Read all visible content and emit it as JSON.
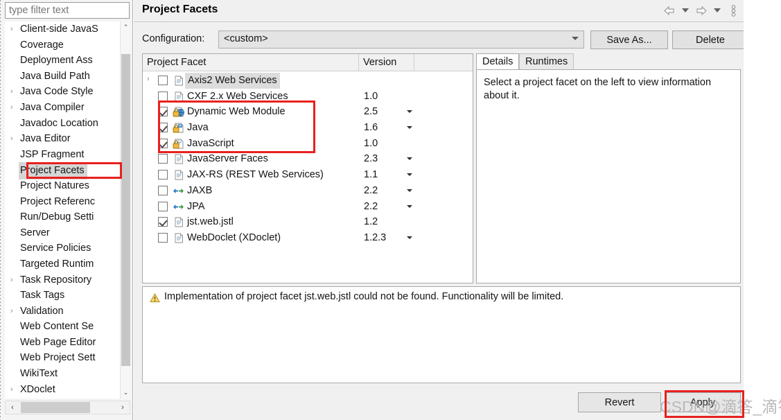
{
  "sidebar": {
    "filter": {
      "placeholder": "type filter text",
      "value": ""
    },
    "items": [
      {
        "label": "Client-side JavaS",
        "expandable": true,
        "selected": false
      },
      {
        "label": "Coverage",
        "expandable": false,
        "selected": false
      },
      {
        "label": "Deployment Ass",
        "expandable": false,
        "selected": false
      },
      {
        "label": "Java Build Path",
        "expandable": false,
        "selected": false
      },
      {
        "label": "Java Code Style",
        "expandable": true,
        "selected": false
      },
      {
        "label": "Java Compiler",
        "expandable": true,
        "selected": false
      },
      {
        "label": "Javadoc Location",
        "expandable": false,
        "selected": false
      },
      {
        "label": "Java Editor",
        "expandable": true,
        "selected": false
      },
      {
        "label": "JSP Fragment",
        "expandable": false,
        "selected": false
      },
      {
        "label": "Project Facets",
        "expandable": false,
        "selected": true
      },
      {
        "label": "Project Natures",
        "expandable": false,
        "selected": false
      },
      {
        "label": "Project Referenc",
        "expandable": false,
        "selected": false
      },
      {
        "label": "Run/Debug Setti",
        "expandable": false,
        "selected": false
      },
      {
        "label": "Server",
        "expandable": false,
        "selected": false
      },
      {
        "label": "Service Policies",
        "expandable": false,
        "selected": false
      },
      {
        "label": "Targeted Runtim",
        "expandable": false,
        "selected": false
      },
      {
        "label": "Task Repository",
        "expandable": true,
        "selected": false
      },
      {
        "label": "Task Tags",
        "expandable": false,
        "selected": false
      },
      {
        "label": "Validation",
        "expandable": true,
        "selected": false
      },
      {
        "label": "Web Content Se",
        "expandable": false,
        "selected": false
      },
      {
        "label": "Web Page Editor",
        "expandable": false,
        "selected": false
      },
      {
        "label": "Web Project Sett",
        "expandable": false,
        "selected": false
      },
      {
        "label": "WikiText",
        "expandable": false,
        "selected": false
      },
      {
        "label": "XDoclet",
        "expandable": true,
        "selected": false
      }
    ],
    "scroll_up_glyph": "⌃",
    "scroll_down_glyph": "⌄",
    "scroll_left_glyph": "‹",
    "scroll_right_glyph": "›"
  },
  "header": {
    "title": "Project Facets",
    "nav_icons": [
      "back-arrow-icon",
      "back-dropdown-icon",
      "forward-arrow-icon",
      "forward-dropdown-icon",
      "view-menu-icon"
    ]
  },
  "configuration": {
    "label": "Configuration:",
    "value": "<custom>",
    "save_as_label": "Save As...",
    "delete_label": "Delete"
  },
  "facets_table": {
    "columns": [
      "Project Facet",
      "Version",
      ""
    ],
    "rows": [
      {
        "name": "Axis2 Web Services",
        "version": "",
        "checked": false,
        "expandable": true,
        "locked": false,
        "icon": "doc-icon",
        "has_menu": false,
        "highlighted": true
      },
      {
        "name": "CXF 2.x Web Services",
        "version": "1.0",
        "checked": false,
        "expandable": false,
        "locked": false,
        "icon": "doc-icon",
        "has_menu": false,
        "highlighted": false
      },
      {
        "name": "Dynamic Web Module",
        "version": "2.5",
        "checked": true,
        "expandable": false,
        "locked": true,
        "icon": "web-icon",
        "has_menu": true,
        "highlighted": false
      },
      {
        "name": "Java",
        "version": "1.6",
        "checked": true,
        "expandable": false,
        "locked": true,
        "icon": "java-icon",
        "has_menu": true,
        "highlighted": false
      },
      {
        "name": "JavaScript",
        "version": "1.0",
        "checked": true,
        "expandable": false,
        "locked": true,
        "icon": "js-icon",
        "has_menu": false,
        "highlighted": false
      },
      {
        "name": "JavaServer Faces",
        "version": "2.3",
        "checked": false,
        "expandable": false,
        "locked": false,
        "icon": "doc-icon",
        "has_menu": true,
        "highlighted": false
      },
      {
        "name": "JAX-RS (REST Web Services)",
        "version": "1.1",
        "checked": false,
        "expandable": false,
        "locked": false,
        "icon": "doc-icon",
        "has_menu": true,
        "highlighted": false
      },
      {
        "name": "JAXB",
        "version": "2.2",
        "checked": false,
        "expandable": false,
        "locked": false,
        "icon": "arrows-icon",
        "has_menu": true,
        "highlighted": false
      },
      {
        "name": "JPA",
        "version": "2.2",
        "checked": false,
        "expandable": false,
        "locked": false,
        "icon": "arrows-icon",
        "has_menu": true,
        "highlighted": false
      },
      {
        "name": "jst.web.jstl",
        "version": "1.2",
        "checked": true,
        "expandable": false,
        "locked": false,
        "icon": "doc-icon",
        "has_menu": false,
        "highlighted": false
      },
      {
        "name": "WebDoclet (XDoclet)",
        "version": "1.2.3",
        "checked": false,
        "expandable": false,
        "locked": false,
        "icon": "doc-icon",
        "has_menu": true,
        "highlighted": false
      }
    ]
  },
  "details": {
    "tabs": [
      {
        "label": "Details",
        "active": true
      },
      {
        "label": "Runtimes",
        "active": false
      }
    ],
    "message": "Select a project facet on the left to view information about it."
  },
  "warning": {
    "icon": "warning-icon",
    "message": "Implementation of project facet jst.web.jstl could not be found. Functionality will be limited."
  },
  "footer": {
    "revert_label": "Revert",
    "apply_label": "Apply"
  },
  "watermark": {
    "text": "CSDN@滴答_滴答"
  },
  "annotations": {
    "accent_color": "#e8201e",
    "boxes": [
      "sidebar-project-facets",
      "checked-facets-group",
      "apply-button"
    ]
  }
}
